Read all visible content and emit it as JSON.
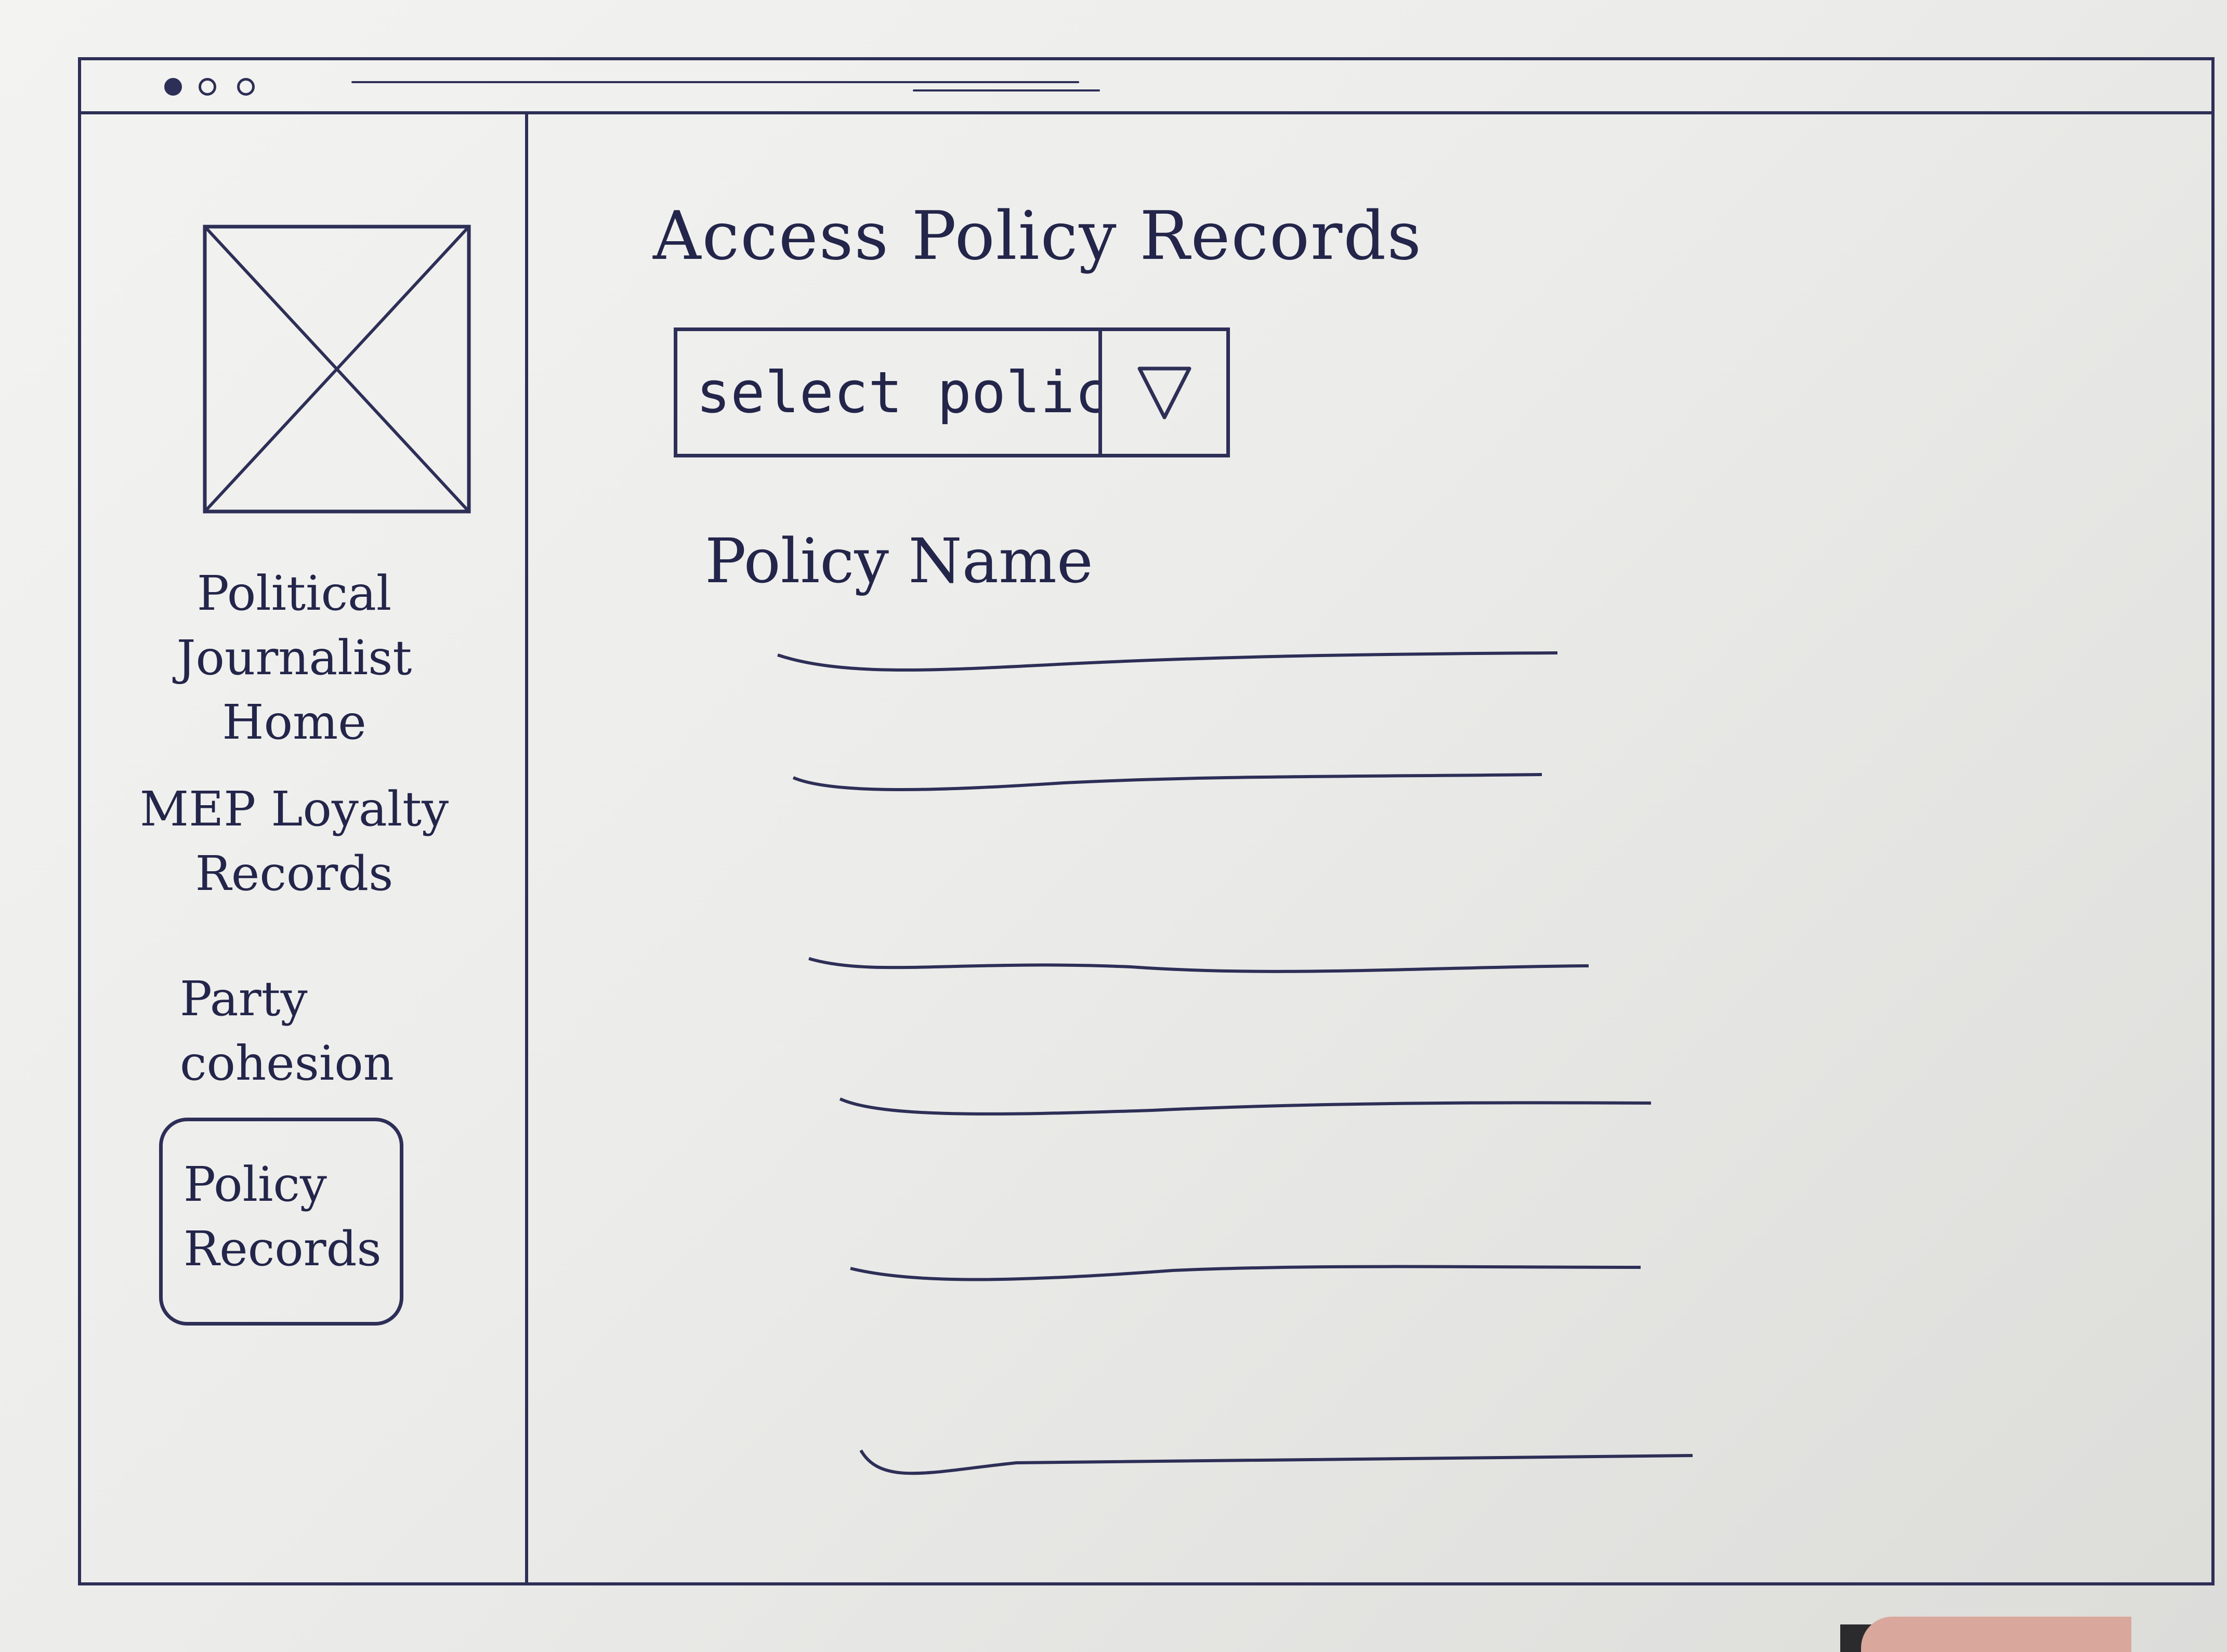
{
  "window": {
    "title": ""
  },
  "sidebar": {
    "logo_icon": "image-placeholder-icon",
    "items": [
      {
        "label_1": "Political",
        "label_2": "Journalist",
        "label_3": "Home"
      },
      {
        "label_1": "MEP Loyalty",
        "label_2": "Records"
      },
      {
        "label_1": "Party",
        "label_2": "cohesion"
      },
      {
        "label_1": "Policy",
        "label_2": "Records",
        "active": true
      }
    ]
  },
  "main": {
    "title": "Access Policy Records",
    "select": {
      "placeholder": "select policy",
      "icon": "triangle-down-icon"
    },
    "column_heading": "Policy Name",
    "rows": [
      "",
      "",
      "",
      "",
      "",
      ""
    ]
  },
  "colors": {
    "ink": "#2d2f57",
    "paper": "#ececea"
  }
}
